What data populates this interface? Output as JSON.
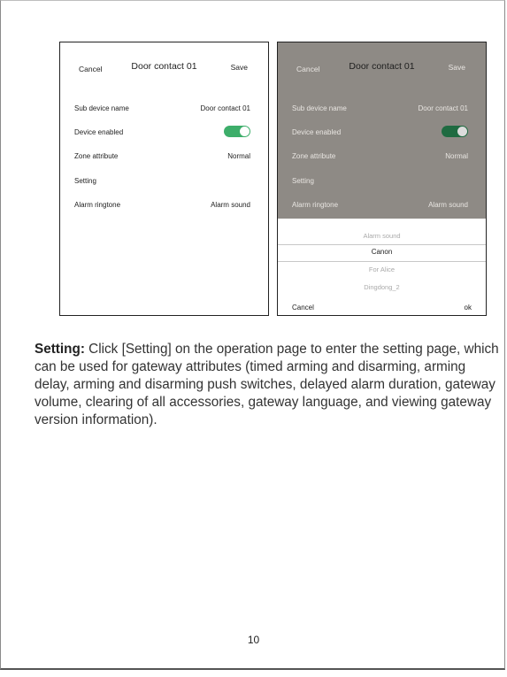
{
  "left_screen": {
    "header": {
      "cancel": "Cancel",
      "title": "Door contact 01",
      "save": "Save"
    },
    "rows": [
      {
        "label": "Sub device name",
        "value": "Door contact 01"
      },
      {
        "label": "Device enabled",
        "toggle_on": true
      },
      {
        "label": "Zone attribute",
        "value": "Normal"
      },
      {
        "label": "Setting"
      },
      {
        "label": "Alarm ringtone",
        "value": "Alarm sound"
      }
    ]
  },
  "right_screen": {
    "header": {
      "cancel": "Cancel",
      "title": "Door contact 01",
      "save": "Save"
    },
    "rows": [
      {
        "label": "Sub device name",
        "value": "Door contact 01"
      },
      {
        "label": "Device enabled",
        "toggle_on": true
      },
      {
        "label": "Zone attribute",
        "value": "Normal"
      },
      {
        "label": "Setting"
      },
      {
        "label": "Alarm ringtone",
        "value": "Alarm sound"
      }
    ],
    "picker": {
      "options": [
        "Alarm sound",
        "Canon",
        "For Alice",
        "Dingdong_2"
      ],
      "selected": "Canon",
      "cancel": "Cancel",
      "ok": "ok"
    }
  },
  "description": {
    "lead": "Setting:",
    "text": " Click [Setting] on the operation page to enter the setting page, which can be used for gateway attributes (timed arming and disarming, arming delay, arming and disarming push switches, delayed alarm duration, gateway volume, clearing of all accessories, gateway language, and viewing gateway version information)."
  },
  "page_number": "10",
  "colors": {
    "toggle_on": "#3dae6a",
    "dim_overlay": "#8e8a85"
  }
}
